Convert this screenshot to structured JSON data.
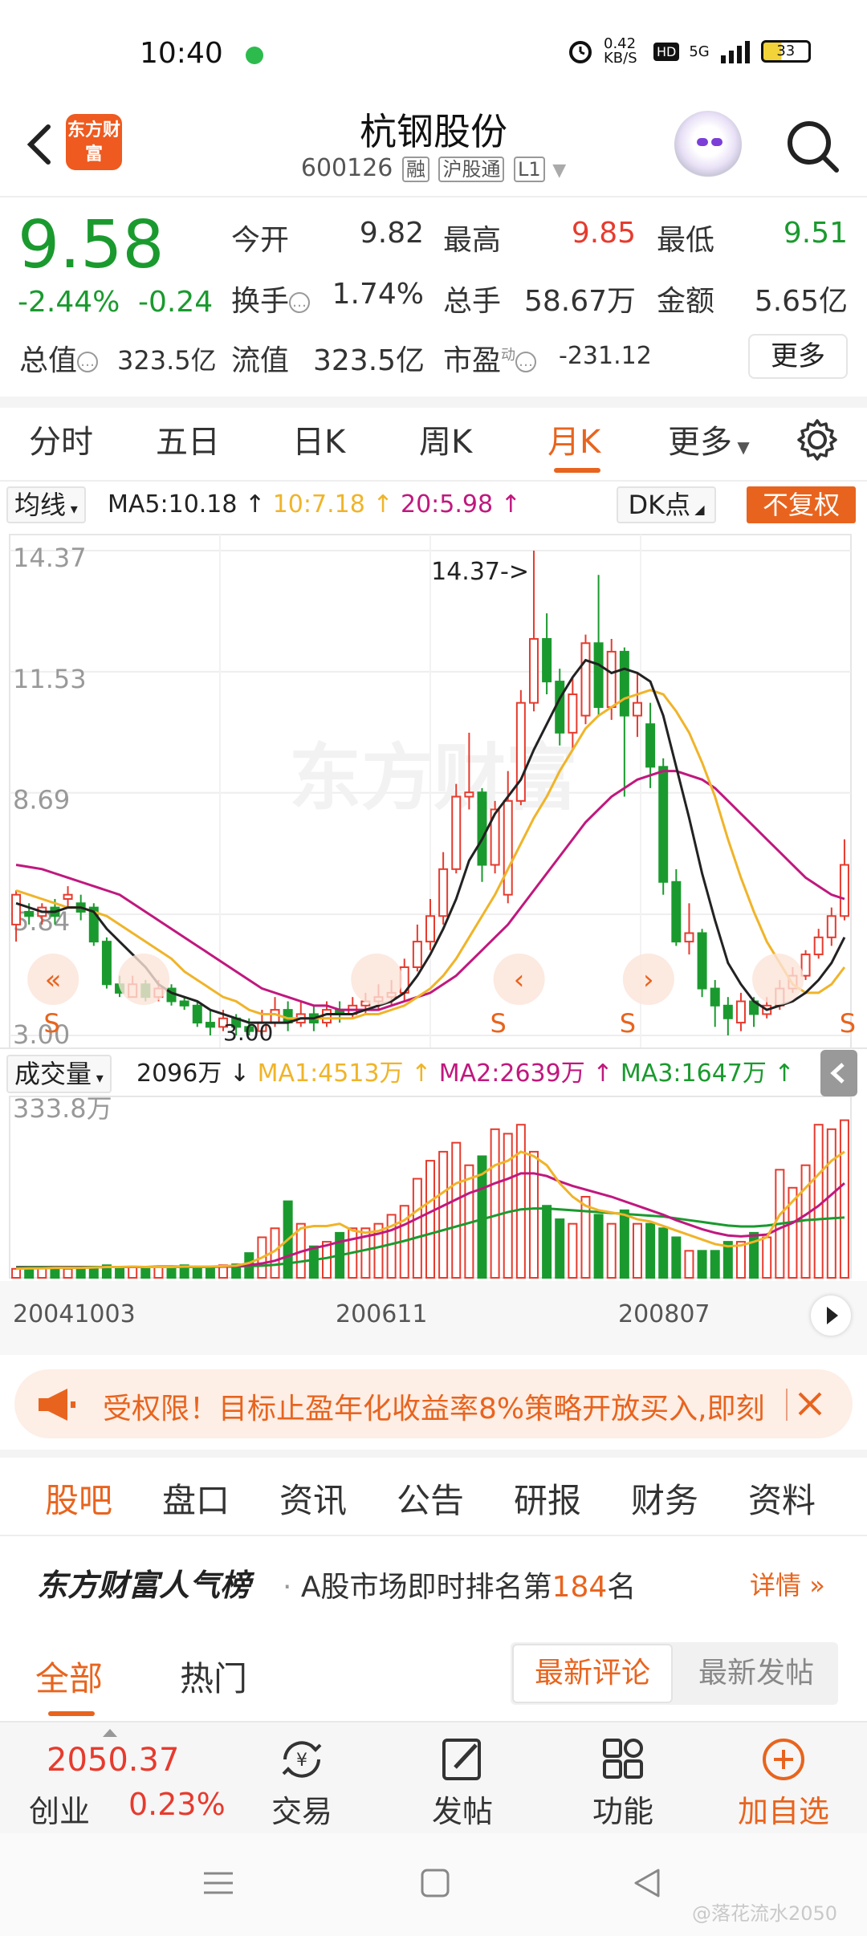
{
  "status_bar": {
    "time": "10:40",
    "net_speed": "0.42 KB/S",
    "hd": "HD",
    "signal": "5G",
    "battery": "33"
  },
  "header": {
    "logo_text": "东方财富",
    "stock_name": "杭钢股份",
    "stock_code": "600126",
    "tags": [
      "融",
      "沪股通",
      "L1"
    ]
  },
  "quote": {
    "price": "9.58",
    "change_pct": "-2.44%",
    "change_abs": "-0.24",
    "open_label": "今开",
    "open": "9.82",
    "high_label": "最高",
    "high": "9.85",
    "low_label": "最低",
    "low": "9.51",
    "turnover_label": "换手",
    "turnover": "1.74%",
    "volume_label": "总手",
    "volume": "58.67万",
    "amount_label": "金额",
    "amount": "5.65亿",
    "total_mv_label": "总值",
    "total_mv": "323.5亿",
    "float_mv_label": "流值",
    "float_mv": "323.5亿",
    "pe_label": "市盈",
    "pe_sup": "动",
    "pe": "-231.12",
    "more_label": "更多"
  },
  "period_tabs": [
    "分时",
    "五日",
    "日K",
    "周K",
    "月K",
    "更多"
  ],
  "period_active": "月K",
  "ma_legend": {
    "select_label": "均线",
    "ma5": "MA5:10.18",
    "ma10": "10:7.18",
    "ma20": "20:5.98",
    "dk_label": "DK点",
    "fq_label": "不复权"
  },
  "volume_legend": {
    "select_label": "成交量",
    "vol": "2096万",
    "ma1": "MA1:4513万",
    "ma2": "MA2:2639万",
    "ma3": "MA3:1647万"
  },
  "colors": {
    "up": "#e63b2e",
    "down": "#1a9a2e",
    "ma5": "#222222",
    "ma10": "#f0b429",
    "ma20": "#c0187e",
    "vol_ma3": "#1a9a2e",
    "accent": "#e8641e"
  },
  "chart_data": {
    "type": "candlestick",
    "y_ticks": [
      "14.37",
      "11.53",
      "8.69",
      "5.84",
      "3.00"
    ],
    "ylim": [
      3.0,
      14.37
    ],
    "max_annotation": "14.37->",
    "min_annotation": "3.00",
    "x_ticks": [
      "20041003",
      "200611",
      "200807"
    ],
    "signal_marks": [
      "S",
      "S",
      "S",
      "S"
    ],
    "candles": [
      {
        "o": 5.6,
        "c": 6.3,
        "h": 6.4,
        "l": 5.2
      },
      {
        "o": 5.9,
        "c": 5.8,
        "h": 6.1,
        "l": 5.6
      },
      {
        "o": 5.8,
        "c": 6.0,
        "h": 6.1,
        "l": 5.6
      },
      {
        "o": 6.0,
        "c": 5.8,
        "h": 6.2,
        "l": 5.6
      },
      {
        "o": 6.2,
        "c": 6.3,
        "h": 6.5,
        "l": 6.0
      },
      {
        "o": 6.1,
        "c": 5.9,
        "h": 6.3,
        "l": 5.7
      },
      {
        "o": 6.0,
        "c": 5.2,
        "h": 6.1,
        "l": 5.1
      },
      {
        "o": 5.2,
        "c": 4.2,
        "h": 5.3,
        "l": 4.1
      },
      {
        "o": 4.2,
        "c": 4.0,
        "h": 4.4,
        "l": 3.9
      },
      {
        "o": 3.9,
        "c": 4.2,
        "h": 4.4,
        "l": 3.9
      },
      {
        "o": 4.2,
        "c": 3.9,
        "h": 4.3,
        "l": 3.8
      },
      {
        "o": 3.9,
        "c": 4.1,
        "h": 4.3,
        "l": 3.8
      },
      {
        "o": 4.1,
        "c": 3.8,
        "h": 4.2,
        "l": 3.7
      },
      {
        "o": 3.8,
        "c": 3.7,
        "h": 3.9,
        "l": 3.6
      },
      {
        "o": 3.7,
        "c": 3.3,
        "h": 3.8,
        "l": 3.2
      },
      {
        "o": 3.3,
        "c": 3.2,
        "h": 3.6,
        "l": 3.0
      },
      {
        "o": 3.2,
        "c": 3.4,
        "h": 3.6,
        "l": 3.1
      },
      {
        "o": 3.4,
        "c": 3.2,
        "h": 3.5,
        "l": 3.0
      },
      {
        "o": 3.2,
        "c": 3.1,
        "h": 3.4,
        "l": 3.0
      },
      {
        "o": 3.1,
        "c": 3.3,
        "h": 3.6,
        "l": 3.0
      },
      {
        "o": 3.3,
        "c": 3.6,
        "h": 3.9,
        "l": 3.2
      },
      {
        "o": 3.6,
        "c": 3.3,
        "h": 3.8,
        "l": 3.1
      },
      {
        "o": 3.3,
        "c": 3.5,
        "h": 3.8,
        "l": 3.2
      },
      {
        "o": 3.5,
        "c": 3.3,
        "h": 3.7,
        "l": 3.1
      },
      {
        "o": 3.3,
        "c": 3.6,
        "h": 3.8,
        "l": 3.2
      },
      {
        "o": 3.6,
        "c": 3.5,
        "h": 3.8,
        "l": 3.3
      },
      {
        "o": 3.5,
        "c": 3.7,
        "h": 3.9,
        "l": 3.4
      },
      {
        "o": 3.7,
        "c": 3.8,
        "h": 4.0,
        "l": 3.5
      },
      {
        "o": 3.8,
        "c": 3.9,
        "h": 4.2,
        "l": 3.6
      },
      {
        "o": 3.9,
        "c": 4.0,
        "h": 4.3,
        "l": 3.7
      },
      {
        "o": 4.0,
        "c": 4.6,
        "h": 4.8,
        "l": 3.8
      },
      {
        "o": 4.6,
        "c": 5.2,
        "h": 5.6,
        "l": 4.5
      },
      {
        "o": 5.2,
        "c": 5.8,
        "h": 6.2,
        "l": 5.0
      },
      {
        "o": 5.8,
        "c": 6.9,
        "h": 7.3,
        "l": 5.6
      },
      {
        "o": 6.9,
        "c": 8.6,
        "h": 8.9,
        "l": 6.8
      },
      {
        "o": 8.6,
        "c": 8.7,
        "h": 10.1,
        "l": 8.3
      },
      {
        "o": 8.7,
        "c": 7.0,
        "h": 8.8,
        "l": 6.6
      },
      {
        "o": 7.0,
        "c": 8.3,
        "h": 8.5,
        "l": 6.8
      },
      {
        "o": 6.3,
        "c": 8.5,
        "h": 9.2,
        "l": 6.1
      },
      {
        "o": 8.5,
        "c": 10.8,
        "h": 11.1,
        "l": 8.4
      },
      {
        "o": 10.8,
        "c": 12.3,
        "h": 14.37,
        "l": 10.6
      },
      {
        "o": 12.3,
        "c": 11.3,
        "h": 12.9,
        "l": 11.0
      },
      {
        "o": 11.3,
        "c": 10.1,
        "h": 11.6,
        "l": 9.8
      },
      {
        "o": 10.1,
        "c": 11.0,
        "h": 11.4,
        "l": 9.7
      },
      {
        "o": 10.5,
        "c": 12.2,
        "h": 12.4,
        "l": 10.3
      },
      {
        "o": 12.2,
        "c": 10.7,
        "h": 13.8,
        "l": 10.5
      },
      {
        "o": 10.7,
        "c": 12.0,
        "h": 12.3,
        "l": 10.4
      },
      {
        "o": 12.0,
        "c": 10.5,
        "h": 12.1,
        "l": 8.6
      },
      {
        "o": 10.5,
        "c": 10.8,
        "h": 11.5,
        "l": 10.0
      },
      {
        "o": 10.3,
        "c": 9.3,
        "h": 10.8,
        "l": 8.8
      },
      {
        "o": 9.3,
        "c": 6.6,
        "h": 9.5,
        "l": 6.3
      },
      {
        "o": 6.6,
        "c": 5.2,
        "h": 6.9,
        "l": 5.1
      },
      {
        "o": 5.2,
        "c": 5.4,
        "h": 6.1,
        "l": 4.9
      },
      {
        "o": 5.4,
        "c": 4.1,
        "h": 5.5,
        "l": 3.9
      },
      {
        "o": 4.1,
        "c": 3.7,
        "h": 4.3,
        "l": 3.2
      },
      {
        "o": 3.7,
        "c": 3.4,
        "h": 3.9,
        "l": 3.0
      },
      {
        "o": 3.3,
        "c": 3.8,
        "h": 4.0,
        "l": 3.1
      },
      {
        "o": 3.8,
        "c": 3.5,
        "h": 3.9,
        "l": 3.2
      },
      {
        "o": 3.5,
        "c": 3.7,
        "h": 3.9,
        "l": 3.4
      },
      {
        "o": 3.7,
        "c": 4.1,
        "h": 4.3,
        "l": 3.6
      },
      {
        "o": 4.1,
        "c": 4.4,
        "h": 4.6,
        "l": 4.0
      },
      {
        "o": 4.4,
        "c": 4.9,
        "h": 5.0,
        "l": 4.3
      },
      {
        "o": 4.9,
        "c": 5.3,
        "h": 5.5,
        "l": 4.8
      },
      {
        "o": 5.3,
        "c": 5.8,
        "h": 6.0,
        "l": 5.1
      },
      {
        "o": 5.8,
        "c": 7.0,
        "h": 7.6,
        "l": 5.7
      }
    ],
    "ma5": [
      6.1,
      6.0,
      5.9,
      5.9,
      6.0,
      6.0,
      5.9,
      5.5,
      5.2,
      4.9,
      4.6,
      4.2,
      4.0,
      3.9,
      3.8,
      3.6,
      3.5,
      3.4,
      3.3,
      3.3,
      3.3,
      3.3,
      3.4,
      3.4,
      3.5,
      3.5,
      3.5,
      3.6,
      3.7,
      3.8,
      4.0,
      4.4,
      4.9,
      5.5,
      6.2,
      7.1,
      7.6,
      8.2,
      8.6,
      9.0,
      9.7,
      10.3,
      10.9,
      11.4,
      11.8,
      11.7,
      11.5,
      11.6,
      11.5,
      11.3,
      10.5,
      9.3,
      8.1,
      6.8,
      5.7,
      4.7,
      4.2,
      3.8,
      3.6,
      3.7,
      3.8,
      4.0,
      4.3,
      4.7,
      5.3
    ],
    "ma10": [
      6.4,
      6.3,
      6.2,
      6.1,
      6.0,
      6.0,
      5.9,
      5.8,
      5.6,
      5.4,
      5.2,
      5.0,
      4.8,
      4.5,
      4.3,
      4.1,
      3.9,
      3.8,
      3.6,
      3.5,
      3.5,
      3.4,
      3.4,
      3.4,
      3.4,
      3.4,
      3.4,
      3.5,
      3.5,
      3.6,
      3.7,
      3.9,
      4.1,
      4.4,
      4.8,
      5.3,
      5.8,
      6.3,
      6.9,
      7.5,
      8.1,
      8.6,
      9.2,
      9.7,
      10.2,
      10.5,
      10.7,
      10.9,
      11.0,
      11.1,
      11.0,
      10.6,
      10.1,
      9.4,
      8.6,
      7.6,
      6.7,
      5.9,
      5.2,
      4.7,
      4.2,
      4.0,
      4.0,
      4.2,
      4.6
    ],
    "ma20": [
      7.0,
      6.95,
      6.9,
      6.8,
      6.7,
      6.6,
      6.5,
      6.4,
      6.3,
      6.1,
      5.9,
      5.7,
      5.5,
      5.3,
      5.1,
      4.9,
      4.7,
      4.5,
      4.3,
      4.1,
      4.0,
      3.9,
      3.8,
      3.7,
      3.7,
      3.6,
      3.6,
      3.6,
      3.6,
      3.7,
      3.8,
      3.9,
      4.0,
      4.2,
      4.4,
      4.7,
      5.0,
      5.3,
      5.6,
      6.0,
      6.4,
      6.8,
      7.2,
      7.6,
      8.0,
      8.3,
      8.6,
      8.8,
      9.0,
      9.1,
      9.2,
      9.2,
      9.1,
      9.0,
      8.8,
      8.5,
      8.2,
      7.9,
      7.6,
      7.3,
      7.0,
      6.7,
      6.5,
      6.3,
      6.2
    ],
    "volume_max_label": "333.8万",
    "volumes": [
      20,
      20,
      22,
      25,
      20,
      22,
      25,
      28,
      22,
      25,
      22,
      25,
      25,
      28,
      22,
      25,
      28,
      30,
      55,
      90,
      110,
      170,
      120,
      70,
      80,
      100,
      110,
      110,
      120,
      140,
      160,
      220,
      260,
      280,
      300,
      250,
      270,
      330,
      320,
      340,
      280,
      160,
      130,
      120,
      180,
      140,
      120,
      150,
      120,
      120,
      110,
      90,
      60,
      60,
      60,
      80,
      80,
      100,
      90,
      240,
      200,
      250,
      340,
      330,
      350
    ],
    "vol_ma1": [
      20,
      21,
      21,
      22,
      22,
      22,
      23,
      24,
      24,
      25,
      24,
      24,
      24,
      25,
      25,
      25,
      26,
      27,
      33,
      45,
      60,
      85,
      110,
      115,
      115,
      120,
      105,
      100,
      104,
      115,
      128,
      150,
      170,
      190,
      210,
      220,
      230,
      250,
      260,
      280,
      270,
      250,
      210,
      180,
      160,
      150,
      145,
      140,
      130,
      125,
      115,
      105,
      95,
      85,
      75,
      70,
      72,
      80,
      90,
      140,
      170,
      200,
      230,
      260,
      280
    ],
    "vol_ma2": [
      22,
      22,
      22,
      23,
      23,
      23,
      23,
      24,
      24,
      24,
      24,
      25,
      25,
      25,
      25,
      25,
      25,
      26,
      28,
      32,
      38,
      48,
      58,
      66,
      72,
      80,
      86,
      92,
      98,
      106,
      118,
      132,
      146,
      160,
      174,
      188,
      198,
      210,
      220,
      232,
      232,
      226,
      214,
      204,
      196,
      188,
      180,
      170,
      160,
      150,
      140,
      128,
      118,
      108,
      100,
      94,
      92,
      94,
      96,
      110,
      122,
      140,
      160,
      185,
      210
    ],
    "vol_ma3": [
      24,
      24,
      24,
      24,
      24,
      24,
      24,
      24,
      24,
      24,
      24,
      24,
      24,
      24,
      24,
      24,
      25,
      25,
      26,
      27,
      29,
      32,
      36,
      40,
      44,
      50,
      56,
      62,
      68,
      75,
      82,
      90,
      98,
      106,
      114,
      122,
      130,
      138,
      146,
      152,
      154,
      154,
      152,
      150,
      148,
      146,
      144,
      142,
      140,
      138,
      136,
      132,
      128,
      124,
      120,
      116,
      114,
      114,
      116,
      120,
      124,
      128,
      130,
      132,
      134
    ]
  },
  "ad_banner": {
    "text": "受权限！目标止盈年化收益率8%策略开放买入,即刻"
  },
  "section_tabs": [
    "股吧",
    "盘口",
    "资讯",
    "公告",
    "研报",
    "财务",
    "资料"
  ],
  "section_active": "股吧",
  "popularity": {
    "title": "东方财富人气榜",
    "desc_prefix": "A股市场即时排名第",
    "rank": "184",
    "desc_suffix": "名",
    "detail": "详情"
  },
  "comment_filter": {
    "all": "全部",
    "hot": "热门",
    "latest_comment": "最新评论",
    "latest_post": "最新发帖"
  },
  "bottom_bar": {
    "index_value": "2050.37",
    "index_name": "创业",
    "index_pct": "0.23%",
    "trade": "交易",
    "post": "发帖",
    "functions": "功能",
    "add_watch": "加自选"
  },
  "watermark": "@落花流水2050"
}
